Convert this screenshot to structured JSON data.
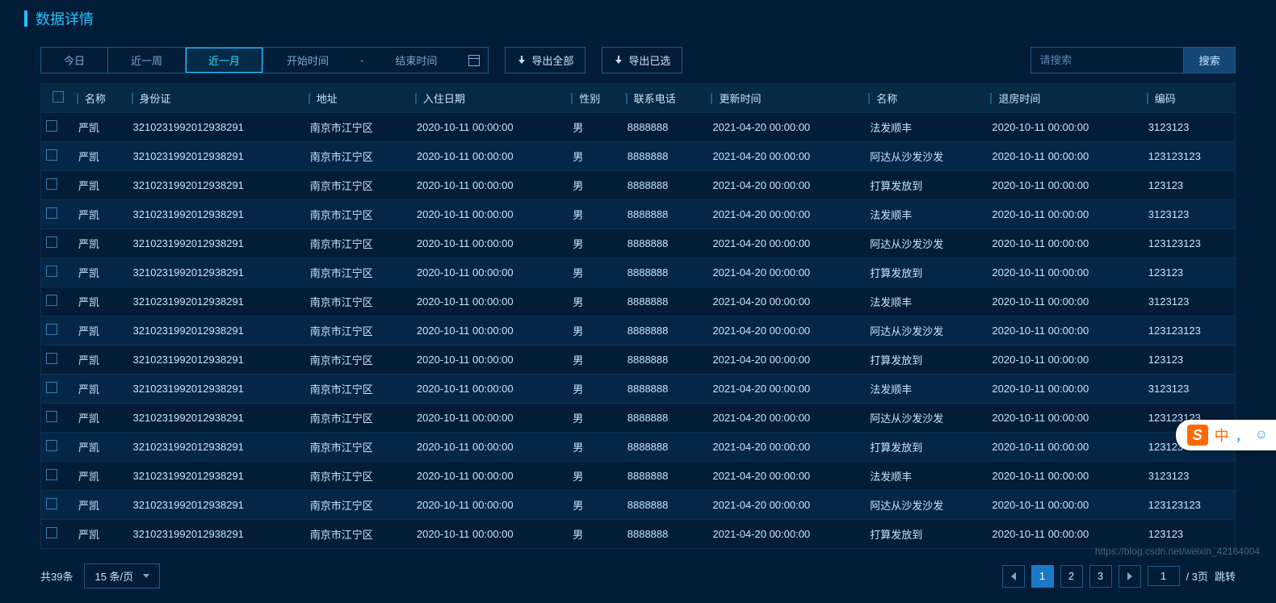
{
  "header": {
    "title": "数据详情"
  },
  "toolbar": {
    "tabs": [
      "今日",
      "近一周",
      "近一月"
    ],
    "active_tab": 2,
    "start_label": "开始时间",
    "range_sep": "-",
    "end_label": "结束时间",
    "export_all": "导出全部",
    "export_selected": "导出已选",
    "search_placeholder": "请搜索",
    "search_btn": "搜索"
  },
  "table": {
    "columns": [
      "名称",
      "身份证",
      "地址",
      "入住日期",
      "性别",
      "联系电话",
      "更新时间",
      "名称",
      "退房时间",
      "编码"
    ],
    "rows": [
      [
        "严凯",
        "3210231992012938291",
        "南京市江宁区",
        "2020-10-11 00:00:00",
        "男",
        "8888888",
        "2021-04-20 00:00:00",
        "法发顺丰",
        "2020-10-11 00:00:00",
        "3123123"
      ],
      [
        "严凯",
        "3210231992012938291",
        "南京市江宁区",
        "2020-10-11 00:00:00",
        "男",
        "8888888",
        "2021-04-20 00:00:00",
        "阿达从沙发沙发",
        "2020-10-11 00:00:00",
        "123123123"
      ],
      [
        "严凯",
        "3210231992012938291",
        "南京市江宁区",
        "2020-10-11 00:00:00",
        "男",
        "8888888",
        "2021-04-20 00:00:00",
        "打算发放到",
        "2020-10-11 00:00:00",
        "123123"
      ],
      [
        "严凯",
        "3210231992012938291",
        "南京市江宁区",
        "2020-10-11 00:00:00",
        "男",
        "8888888",
        "2021-04-20 00:00:00",
        "法发顺丰",
        "2020-10-11 00:00:00",
        "3123123"
      ],
      [
        "严凯",
        "3210231992012938291",
        "南京市江宁区",
        "2020-10-11 00:00:00",
        "男",
        "8888888",
        "2021-04-20 00:00:00",
        "阿达从沙发沙发",
        "2020-10-11 00:00:00",
        "123123123"
      ],
      [
        "严凯",
        "3210231992012938291",
        "南京市江宁区",
        "2020-10-11 00:00:00",
        "男",
        "8888888",
        "2021-04-20 00:00:00",
        "打算发放到",
        "2020-10-11 00:00:00",
        "123123"
      ],
      [
        "严凯",
        "3210231992012938291",
        "南京市江宁区",
        "2020-10-11 00:00:00",
        "男",
        "8888888",
        "2021-04-20 00:00:00",
        "法发顺丰",
        "2020-10-11 00:00:00",
        "3123123"
      ],
      [
        "严凯",
        "3210231992012938291",
        "南京市江宁区",
        "2020-10-11 00:00:00",
        "男",
        "8888888",
        "2021-04-20 00:00:00",
        "阿达从沙发沙发",
        "2020-10-11 00:00:00",
        "123123123"
      ],
      [
        "严凯",
        "3210231992012938291",
        "南京市江宁区",
        "2020-10-11 00:00:00",
        "男",
        "8888888",
        "2021-04-20 00:00:00",
        "打算发放到",
        "2020-10-11 00:00:00",
        "123123"
      ],
      [
        "严凯",
        "3210231992012938291",
        "南京市江宁区",
        "2020-10-11 00:00:00",
        "男",
        "8888888",
        "2021-04-20 00:00:00",
        "法发顺丰",
        "2020-10-11 00:00:00",
        "3123123"
      ],
      [
        "严凯",
        "3210231992012938291",
        "南京市江宁区",
        "2020-10-11 00:00:00",
        "男",
        "8888888",
        "2021-04-20 00:00:00",
        "阿达从沙发沙发",
        "2020-10-11 00:00:00",
        "123123123"
      ],
      [
        "严凯",
        "3210231992012938291",
        "南京市江宁区",
        "2020-10-11 00:00:00",
        "男",
        "8888888",
        "2021-04-20 00:00:00",
        "打算发放到",
        "2020-10-11 00:00:00",
        "123123"
      ],
      [
        "严凯",
        "3210231992012938291",
        "南京市江宁区",
        "2020-10-11 00:00:00",
        "男",
        "8888888",
        "2021-04-20 00:00:00",
        "法发顺丰",
        "2020-10-11 00:00:00",
        "3123123"
      ],
      [
        "严凯",
        "3210231992012938291",
        "南京市江宁区",
        "2020-10-11 00:00:00",
        "男",
        "8888888",
        "2021-04-20 00:00:00",
        "阿达从沙发沙发",
        "2020-10-11 00:00:00",
        "123123123"
      ],
      [
        "严凯",
        "3210231992012938291",
        "南京市江宁区",
        "2020-10-11 00:00:00",
        "男",
        "8888888",
        "2021-04-20 00:00:00",
        "打算发放到",
        "2020-10-11 00:00:00",
        "123123"
      ]
    ]
  },
  "footer": {
    "total_label": "共39条",
    "page_size": "15 条/页",
    "pages": [
      "1",
      "2",
      "3"
    ],
    "active_page": 0,
    "jump_value": "1",
    "jump_suffix": "/ 3页",
    "jump_btn": "跳转"
  },
  "ime": {
    "logo": "S",
    "char": "中",
    "comma": "，"
  },
  "watermark": "https://blog.csdn.net/weixin_42164004"
}
